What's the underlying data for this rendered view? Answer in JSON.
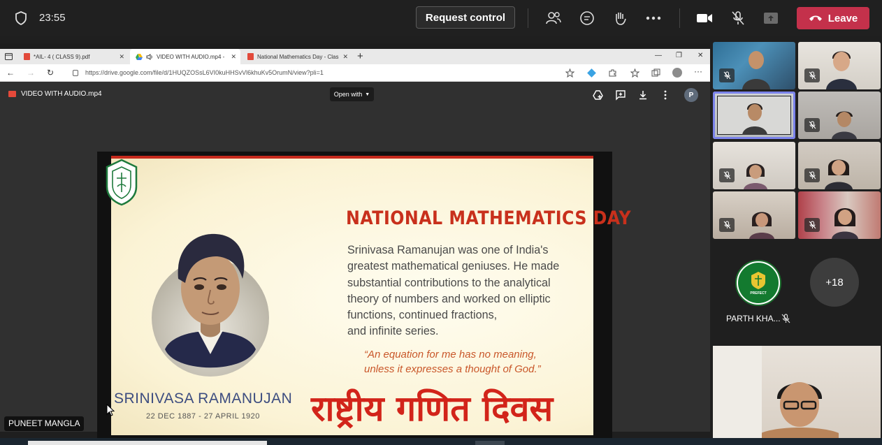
{
  "meeting": {
    "time": "23:55",
    "request_control_label": "Request control",
    "leave_label": "Leave",
    "presenter_name": "PUNEET MANGLA",
    "more_participants": "+18",
    "named_participant": "PARTH KHA...",
    "colors": {
      "leave": "#c4314b",
      "speaking_outline": "#7b83eb",
      "background": "#202020"
    }
  },
  "browser": {
    "tabs": [
      {
        "label": "*AIL- 4 ( CLASS 9).pdf",
        "icon": "pdf-icon"
      },
      {
        "label": "VIDEO WITH AUDIO.mp4 -",
        "icon": "drive-icon"
      },
      {
        "label": "National Mathematics Day - Clas",
        "icon": "pdf-icon"
      }
    ],
    "url": "https://drive.google.com/file/d/1HUQZOSsL6VI0kuHHSvVl6khuKv5OrumN/view?pli=1"
  },
  "drive": {
    "file_name": "VIDEO WITH AUDIO.mp4",
    "open_with_label": "Open with",
    "avatar_letter": "P"
  },
  "slide": {
    "title": "NATIONAL MATHEMATICS DAY",
    "body_lines": [
      "Srinivasa Ramanujan was one of India's",
      "greatest mathematical geniuses.  He made",
      "substantial contributions to the analytical",
      "theory of numbers and worked on elliptic",
      "functions, continued fractions,",
      "and infinite series."
    ],
    "quote_lines": [
      "“An equation for me has no meaning,",
      "unless it expresses a thought of God.”"
    ],
    "name": "SRINIVASA RAMANUJAN",
    "dates": "22 DEC 1887 - 27 APRIL 1920",
    "hindi": "राष्ट्रीय गणित दिवस"
  }
}
